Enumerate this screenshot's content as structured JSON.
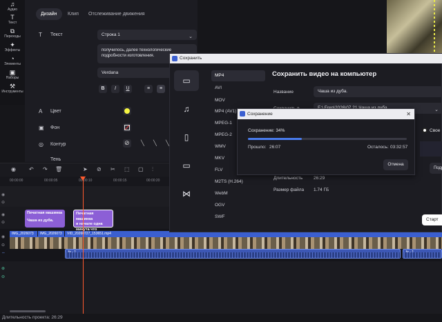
{
  "left_bar": {
    "items": [
      {
        "label": "Аудио",
        "icon": "music-note-icon"
      },
      {
        "label": "Текст",
        "icon": "text-icon"
      },
      {
        "label": "Переходы",
        "icon": "transitions-icon"
      },
      {
        "label": "Эффекты",
        "icon": "effects-icon"
      },
      {
        "label": "Элементы",
        "icon": "elements-icon"
      },
      {
        "label": "Наборы",
        "icon": "sets-icon"
      },
      {
        "label": "Инструменты",
        "icon": "tools-icon"
      }
    ]
  },
  "props": {
    "tabs": [
      "Дизайн",
      "Клип",
      "Отслеживание движения"
    ],
    "text_label": "Текст",
    "text_select": "Строка 1",
    "text_area": "получилось, далее технологические подробности изготовления.",
    "font": "Verdana",
    "format_buttons": [
      "B",
      "I",
      "U"
    ],
    "color_label": "Цвет",
    "background_label": "Фон",
    "outline_label": "Контур",
    "shadow_label": "Тень",
    "accent_yellow": "#f5f542"
  },
  "timeline": {
    "ruler_ticks": [
      "00:00:00",
      "00:00:05",
      "00:00:10",
      "00:00:15",
      "00:00:20"
    ],
    "text_clips": [
      {
        "line1": "Печатная машинка",
        "line2": "Чаша из дуба."
      },
      {
        "line1": "Печатная машинка",
        "line2": "и начале одна",
        "line3": "минута что именно"
      }
    ],
    "video_clips": [
      "IMG_2026073",
      "IMG_2026073",
      "VID_20260727_153651.mp4"
    ],
    "audio_label": "fx - 1"
  },
  "dialog": {
    "title": "Сохранить",
    "heading": "Сохранить видео на компьютер",
    "formats": [
      "MP4",
      "AVI",
      "MOV",
      "MP4 (AV1)",
      "MPEG-1",
      "MPEG-2",
      "WMV",
      "MKV",
      "FLV",
      "M2TS (H.264)",
      "WebM",
      "OGV",
      "SWF"
    ],
    "name_label": "Название",
    "name_value": "Чаша из дуба.",
    "save_to_label": "Сохранить в",
    "save_to_value": "E:\\ Frep\\2026\\07.21 Чаша из дуба",
    "duration_label": "Длительность",
    "duration_value": "26:29",
    "filesize_label": "Размер файла",
    "filesize_value": "1.74 ГБ",
    "own_label": "Свое",
    "more_label": "Подр"
  },
  "progress": {
    "title": "Сохранение",
    "saving_text": "Сохранение:   34%",
    "percent": 34,
    "elapsed_label": "Прошло:",
    "elapsed_value": "26:07",
    "remaining_label": "Осталось:",
    "remaining_value": "03:32:57",
    "cancel_label": "Отмена"
  },
  "start_button": "Старт",
  "status": "Длительность проекта: 26:29"
}
